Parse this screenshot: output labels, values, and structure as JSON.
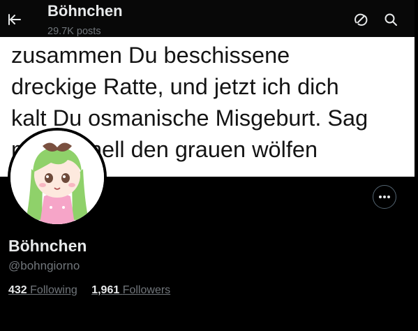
{
  "header": {
    "title": "Böhnchen",
    "posts_count": "29.7K posts"
  },
  "banner": {
    "lines": [
      "zusammen Du beschissene",
      "dreckige Ratte, und jetzt ich dich",
      "kalt Du osmanische Misgeburt. Sag",
      "mal schnell den grauen wölfen"
    ]
  },
  "profile": {
    "display_name": "Böhnchen",
    "handle": "@bohngiorno",
    "following_count": "432",
    "following_label": "Following",
    "followers_count": "1,961",
    "followers_label": "Followers"
  },
  "icons": {
    "back": "back-arrow-icon",
    "grok": "grok-icon",
    "search": "search-icon",
    "more": "more-icon"
  },
  "colors": {
    "background": "#000000",
    "text_primary": "#e7e9ea",
    "text_secondary": "#71767b",
    "border": "#536471",
    "avatar_hair": "#8fd16a",
    "avatar_dress": "#f6a5c8"
  }
}
